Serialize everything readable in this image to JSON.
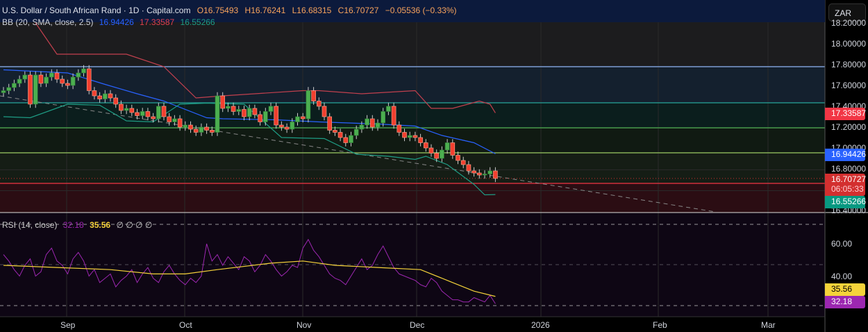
{
  "header": {
    "title": "U.S. Dollar / South African Rand · 1D · Capital.com",
    "open": "O16.75493",
    "high": "H16.76241",
    "low": "L16.68315",
    "close": "C16.70727",
    "change": "−0.05536 (−0.33%)"
  },
  "bb": {
    "label": "BB (20, SMA, close, 2.5)",
    "basis": "16.94426",
    "upper": "17.33587",
    "lower": "16.55266"
  },
  "rsi": {
    "label": "RSI (14, close)",
    "value": "32.18",
    "ma": "35.56",
    "extras": "∅ ∅ ∅ ∅"
  },
  "currency_button": "ZAR",
  "price_axis": [
    "18.20000",
    "18.00000",
    "17.80000",
    "17.60000",
    "17.40000",
    "17.20000",
    "17.00000",
    "16.80000",
    "16.40000"
  ],
  "price_tags": {
    "upper": "17.33587",
    "basis": "16.94426",
    "last": "16.70727",
    "countdown": "06:05:33",
    "lower": "16.55266"
  },
  "rsi_axis": [
    "60.00",
    "40.00"
  ],
  "rsi_tags": {
    "ma": "35.56",
    "rsi": "32.18"
  },
  "time_axis": [
    "Sep",
    "Oct",
    "Nov",
    "Dec",
    "2026",
    "Feb",
    "Mar"
  ],
  "colors": {
    "up": "#4caf50",
    "down": "#f23f2f",
    "bb_upper": "#c2404e",
    "bb_basis": "#2962ff",
    "bb_lower": "#1e9c84",
    "rsi": "#9c27b0",
    "rsi_ma": "#f5d33a"
  },
  "chart_data": {
    "type": "candlestick",
    "wick": 0.035,
    "closes": [
      17.55,
      17.58,
      17.62,
      17.66,
      17.7,
      17.42,
      17.7,
      17.62,
      17.68,
      17.72,
      17.66,
      17.62,
      17.6,
      17.68,
      17.72,
      17.76,
      17.55,
      17.5,
      17.47,
      17.52,
      17.48,
      17.42,
      17.36,
      17.38,
      17.34,
      17.31,
      17.35,
      17.3,
      17.28,
      17.4,
      17.3,
      17.25,
      17.28,
      17.2,
      17.22,
      17.18,
      17.15,
      17.2,
      17.17,
      17.15,
      17.5,
      17.38,
      17.4,
      17.35,
      17.37,
      17.3,
      17.38,
      17.32,
      17.25,
      17.35,
      17.4,
      17.22,
      17.2,
      17.18,
      17.25,
      17.3,
      17.28,
      17.55,
      17.45,
      17.4,
      17.3,
      17.17,
      17.15,
      17.1,
      17.05,
      17.12,
      17.18,
      17.22,
      17.28,
      17.2,
      17.24,
      17.35,
      17.4,
      17.22,
      17.15,
      17.1,
      17.12,
      17.1,
      17.05,
      17.0,
      16.95,
      16.9,
      16.98,
      17.05,
      16.93,
      16.88,
      16.84,
      16.78,
      16.76,
      16.74,
      16.75,
      16.78,
      16.70727
    ],
    "bb_upper": [
      [
        6,
        18.2
      ],
      [
        10,
        17.9
      ],
      [
        23,
        17.9
      ],
      [
        30,
        17.78
      ],
      [
        36,
        17.48
      ],
      [
        41,
        17.5
      ],
      [
        56,
        17.55
      ],
      [
        59,
        17.55
      ],
      [
        67,
        17.52
      ],
      [
        77,
        17.55
      ],
      [
        80,
        17.38
      ],
      [
        84,
        17.38
      ],
      [
        89,
        17.45
      ],
      [
        91,
        17.42
      ],
      [
        92,
        17.33587
      ]
    ],
    "bb_basis": [
      [
        0,
        17.75
      ],
      [
        12,
        17.72
      ],
      [
        19,
        17.61
      ],
      [
        25,
        17.52
      ],
      [
        30,
        17.45
      ],
      [
        38,
        17.29
      ],
      [
        41,
        17.28
      ],
      [
        51,
        17.27
      ],
      [
        59,
        17.25
      ],
      [
        70,
        17.23
      ],
      [
        77,
        17.21
      ],
      [
        82,
        17.12
      ],
      [
        88,
        17.05
      ],
      [
        92,
        16.94426
      ]
    ],
    "bb_lower": [
      [
        0,
        17.3
      ],
      [
        5,
        17.29
      ],
      [
        12,
        17.42
      ],
      [
        18,
        17.41
      ],
      [
        23,
        17.26
      ],
      [
        28,
        17.25
      ],
      [
        33,
        17.42
      ],
      [
        38,
        17.43
      ],
      [
        45,
        17.42
      ],
      [
        52,
        17.1
      ],
      [
        60,
        17.09
      ],
      [
        66,
        16.94
      ],
      [
        72,
        16.92
      ],
      [
        77,
        16.89
      ],
      [
        79,
        16.92
      ],
      [
        83,
        16.84
      ],
      [
        88,
        16.65
      ],
      [
        90,
        16.55
      ],
      [
        92,
        16.55266
      ]
    ],
    "rsi": [
      55,
      52,
      48,
      45,
      50,
      53,
      45,
      47,
      55,
      58,
      52,
      50,
      46,
      53,
      56,
      52,
      45,
      48,
      42,
      44,
      46,
      40,
      43,
      45,
      48,
      42,
      46,
      49,
      44,
      42,
      47,
      50,
      46,
      43,
      41,
      44,
      42,
      45,
      60,
      52,
      55,
      50,
      54,
      51,
      48,
      54,
      52,
      47,
      50,
      55,
      52,
      48,
      45,
      47,
      50,
      49,
      58,
      62,
      57,
      54,
      50,
      46,
      44,
      43,
      41,
      45,
      49,
      53,
      48,
      50,
      55,
      59,
      54,
      49,
      46,
      45,
      44,
      43,
      41,
      40,
      44,
      42,
      38,
      36,
      34,
      34,
      33,
      33,
      35,
      34,
      33,
      36,
      32.18
    ],
    "rsi_ma": [
      [
        0,
        50
      ],
      [
        10,
        49
      ],
      [
        20,
        48
      ],
      [
        28,
        46
      ],
      [
        34,
        46
      ],
      [
        40,
        48
      ],
      [
        50,
        51
      ],
      [
        56,
        52
      ],
      [
        62,
        50
      ],
      [
        70,
        49
      ],
      [
        78,
        48
      ],
      [
        84,
        42
      ],
      [
        88,
        38
      ],
      [
        92,
        35.56
      ]
    ]
  }
}
